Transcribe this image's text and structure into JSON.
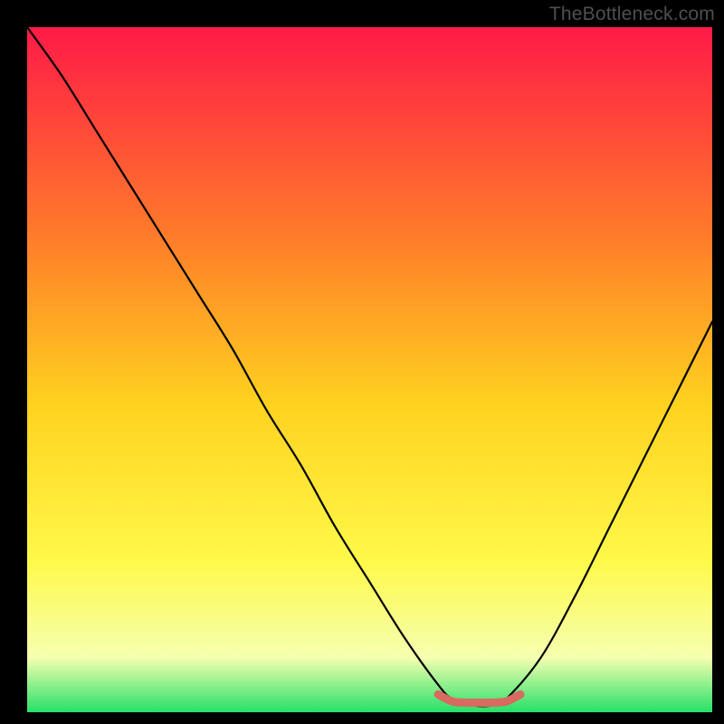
{
  "watermark": "TheBottleneck.com",
  "colors": {
    "page_bg": "#000000",
    "gradient_top": "#ff1a47",
    "gradient_mid_upper": "#ff7a2a",
    "gradient_mid": "#ffd21f",
    "gradient_mid_lower": "#fff94a",
    "gradient_lower": "#f6ffb0",
    "gradient_bottom": "#26e069",
    "curve": "#000000",
    "marker": "#d86a5f"
  },
  "chart_data": {
    "type": "line",
    "title": "",
    "xlabel": "",
    "ylabel": "",
    "xlim": [
      0,
      100
    ],
    "ylim": [
      0,
      100
    ],
    "grid": false,
    "legend": false,
    "annotations": [],
    "series": [
      {
        "name": "bottleneck-curve",
        "x": [
          0,
          5,
          10,
          15,
          20,
          25,
          30,
          35,
          40,
          45,
          50,
          55,
          60,
          62,
          65,
          68,
          70,
          75,
          80,
          85,
          90,
          95,
          100
        ],
        "values": [
          100,
          93,
          85,
          77,
          69,
          61,
          53,
          44,
          36,
          27,
          19,
          11,
          4,
          2,
          1,
          1,
          2,
          8,
          17,
          27,
          37,
          47,
          57
        ]
      },
      {
        "name": "optimal-region-marker",
        "x": [
          60,
          62,
          64,
          66,
          68,
          70,
          72
        ],
        "values": [
          2.6,
          1.6,
          1.4,
          1.4,
          1.4,
          1.6,
          2.6
        ]
      }
    ]
  }
}
